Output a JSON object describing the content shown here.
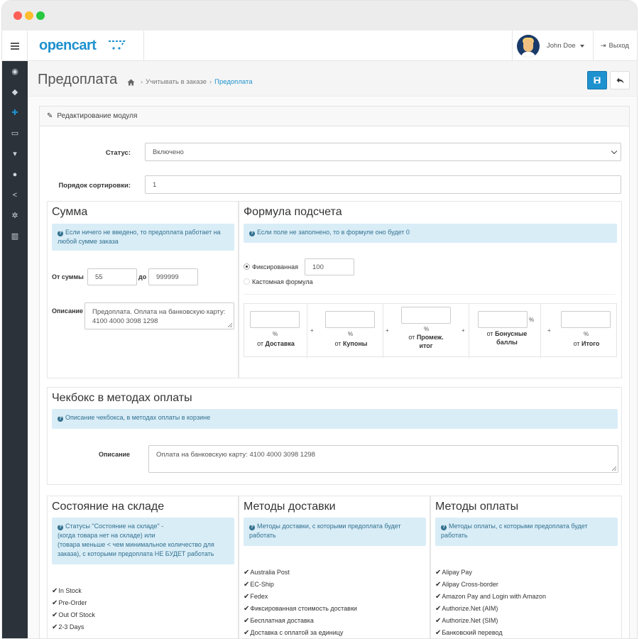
{
  "user": {
    "name": "John Doe",
    "logout": "Выход"
  },
  "brand": {
    "logo": "opencart",
    "color": "#1e91cf"
  },
  "sidebar": {
    "icons": [
      "dashboard-icon",
      "tags-icon",
      "puzzle-icon",
      "desktop-icon",
      "cart-icon",
      "user-icon",
      "share-icon",
      "cog-icon",
      "bar-chart-icon"
    ]
  },
  "page": {
    "title": "Предоплата",
    "breadcrumb": [
      "Учитывать в заказе",
      "Предоплата"
    ]
  },
  "panel": {
    "heading": "Редактирование модуля"
  },
  "form": {
    "status_label": "Статус:",
    "status_value": "Включено",
    "sort_label": "Порядок сортировки:",
    "sort_value": "1"
  },
  "sum": {
    "title": "Сумма",
    "alert": "Если ничего не введено, то предоплата работает на любой сумме заказа",
    "from_label": "От суммы",
    "from_value": "55",
    "to_label": "до",
    "to_value": "999999",
    "desc_label": "Описание",
    "desc_value": "Предоплата.  Оплата на банковскую карту: 4100 4000 3098 1298"
  },
  "formula": {
    "title": "Формула подсчета",
    "alert": "Если поле не заполнено, то в формуле оно будет 0",
    "fixed_label": "Фиксированная",
    "fixed_value": "100",
    "custom_label": "Кастомная формула",
    "percent": "%",
    "plus": "+",
    "from": "от",
    "cells": [
      "Доставка",
      "Купоны",
      "Промеж. итог",
      "Бонусные баллы",
      "Итого"
    ]
  },
  "checkbox_section": {
    "title": "Чекбокс в методах оплаты",
    "alert": "Описание чекбокса, в методах оплаты в корзине",
    "desc_label": "Описание",
    "desc_value": "Оплата на банковскую карту: 4100 4000 3098 1298"
  },
  "stock": {
    "title": "Состояние на складе",
    "alert_line1": "Статусы \"Состояние на складе\" -",
    "alert_line2": "(когда товара нет на складе) или",
    "alert_line3": "(товара меньше < чем минимальное количество для",
    "alert_line4": "заказа), с которыми предоплата НЕ БУДЕТ работать",
    "items": [
      "In Stock",
      "Pre-Order",
      "Out Of Stock",
      "2-3 Days"
    ]
  },
  "shipping": {
    "title": "Методы доставки",
    "alert": "Методы доставки, с которыми предоплата будет работать",
    "items": [
      "Australia Post",
      "EC-Ship",
      "Fedex",
      "Фиксированная стоимость доставки",
      "Бесплатная доставка",
      "Доставка с оплатой за единицу"
    ]
  },
  "payment": {
    "title": "Методы оплаты",
    "alert": "Методы оплаты, с которыми предоплата будет работать",
    "items": [
      "Alipay Pay",
      "Alipay Cross-border",
      "Amazon Pay and Login with Amazon",
      "Authorize.Net (AIM)",
      "Authorize.Net (SIM)",
      "Банковский перевод"
    ]
  }
}
